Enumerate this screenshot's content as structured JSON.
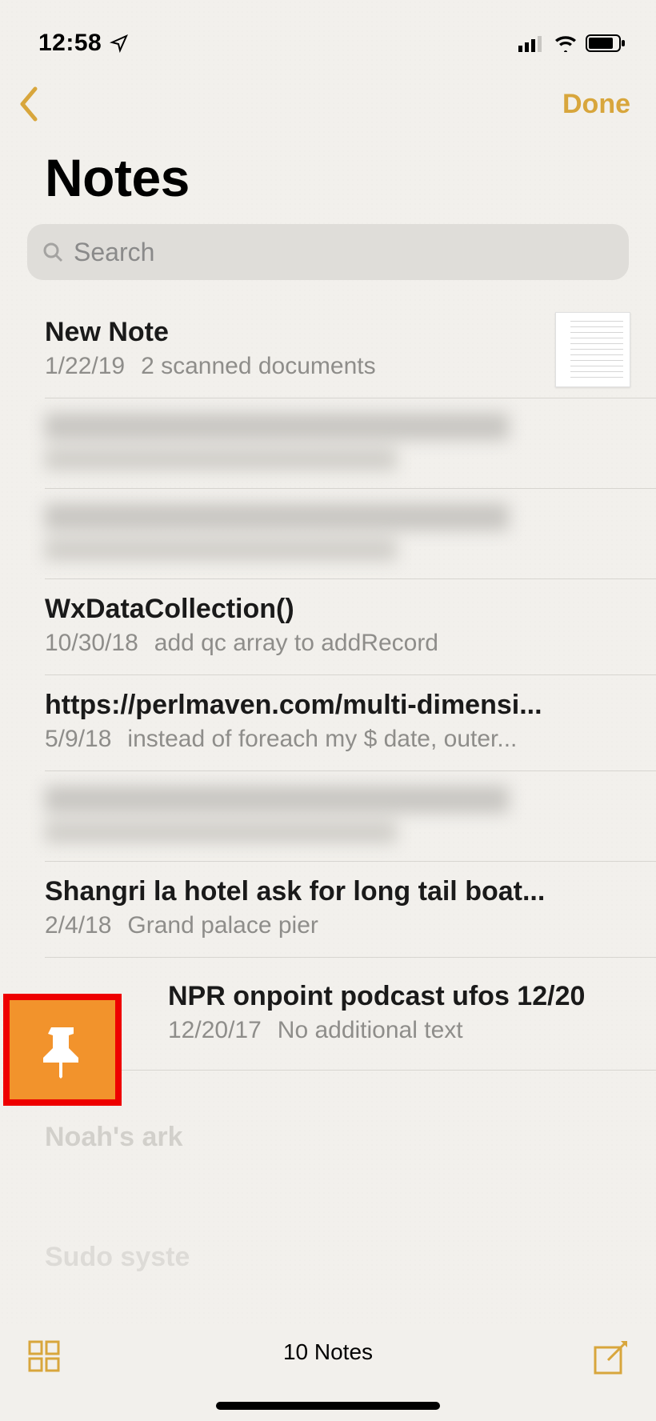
{
  "status": {
    "time": "12:58",
    "location_active": true
  },
  "nav": {
    "done_label": "Done"
  },
  "title": "Notes",
  "search": {
    "placeholder": "Search"
  },
  "notes": [
    {
      "title": "New Note",
      "date": "1/22/19",
      "preview": "2 scanned documents",
      "has_thumb": true
    },
    {
      "redacted": true
    },
    {
      "redacted": true
    },
    {
      "title": "WxDataCollection()",
      "date": "10/30/18",
      "preview": "add qc array to addRecord"
    },
    {
      "title": "https://perlmaven.com/multi-dimensi...",
      "date": "5/9/18",
      "preview": "instead of foreach my $ date, outer..."
    },
    {
      "redacted": true
    },
    {
      "title": "Shangri la hotel ask for long tail boat...",
      "date": "2/4/18",
      "preview": "Grand palace pier"
    },
    {
      "title": "NPR onpoint podcast ufos 12/20",
      "date": "12/20/17",
      "preview": "No additional text",
      "pinned": true
    }
  ],
  "overflow_hints": [
    "Noah's ark",
    "Sudo syste"
  ],
  "footer": {
    "count_label": "10 Notes"
  },
  "colors": {
    "accent": "#d8a63c",
    "pin_action_bg": "#f2932c",
    "pin_action_border": "#ee0000"
  }
}
